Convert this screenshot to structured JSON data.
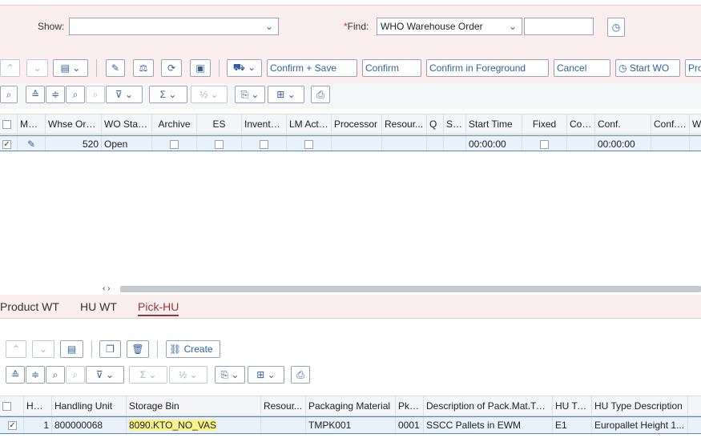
{
  "filter": {
    "show_label": "Show:",
    "show_value": "",
    "find_label": "Find:",
    "find_value": "WHO Warehouse Order",
    "find_input_value": ""
  },
  "toolbar1": {
    "confirm_save": "Confirm + Save",
    "confirm": "Confirm",
    "confirm_fg": "Confirm in Foreground",
    "cancel": "Cancel",
    "start_wo": "Start WO",
    "pro": "Pro"
  },
  "wo_grid": {
    "headers": [
      "Mode",
      "Whse Ord...",
      "WO Status",
      "Archive",
      "ES",
      "Inventory",
      "LM Active",
      "Processor",
      "Resour...",
      "Q",
      "St...",
      "Start Time",
      "Fixed",
      "Conf.",
      "Conf.",
      "Conf. by",
      "W"
    ],
    "row": {
      "whse_order": "520",
      "status": "Open",
      "start_time": "00:00:00",
      "conf_time": "00:00:00"
    }
  },
  "tabs": [
    "Product WT",
    "HU WT",
    "Pick-HU"
  ],
  "hu_toolbar": {
    "create": "Create"
  },
  "hu_grid": {
    "headers": [
      "HU ...",
      "Handling Unit",
      "Storage Bin",
      "Resour...",
      "Packaging Material",
      "PkM...",
      "Description of Pack.Mat.Type",
      "HU Ty...",
      "HU Type Description"
    ],
    "row": {
      "hu": "1",
      "handling_unit": "800000068",
      "storage_bin": "8090.KTO_NO_VAS",
      "resource": "",
      "packaging_material": "TMPK001",
      "pkm": "0001",
      "desc": "SSCC Pallets in EWM",
      "hu_type": "E1",
      "hu_type_desc": "Europallet Height 1..."
    }
  },
  "colors": {
    "accent": "#315e9a",
    "header_bg": "#fbeeee",
    "highlight": "#f7f28a"
  }
}
